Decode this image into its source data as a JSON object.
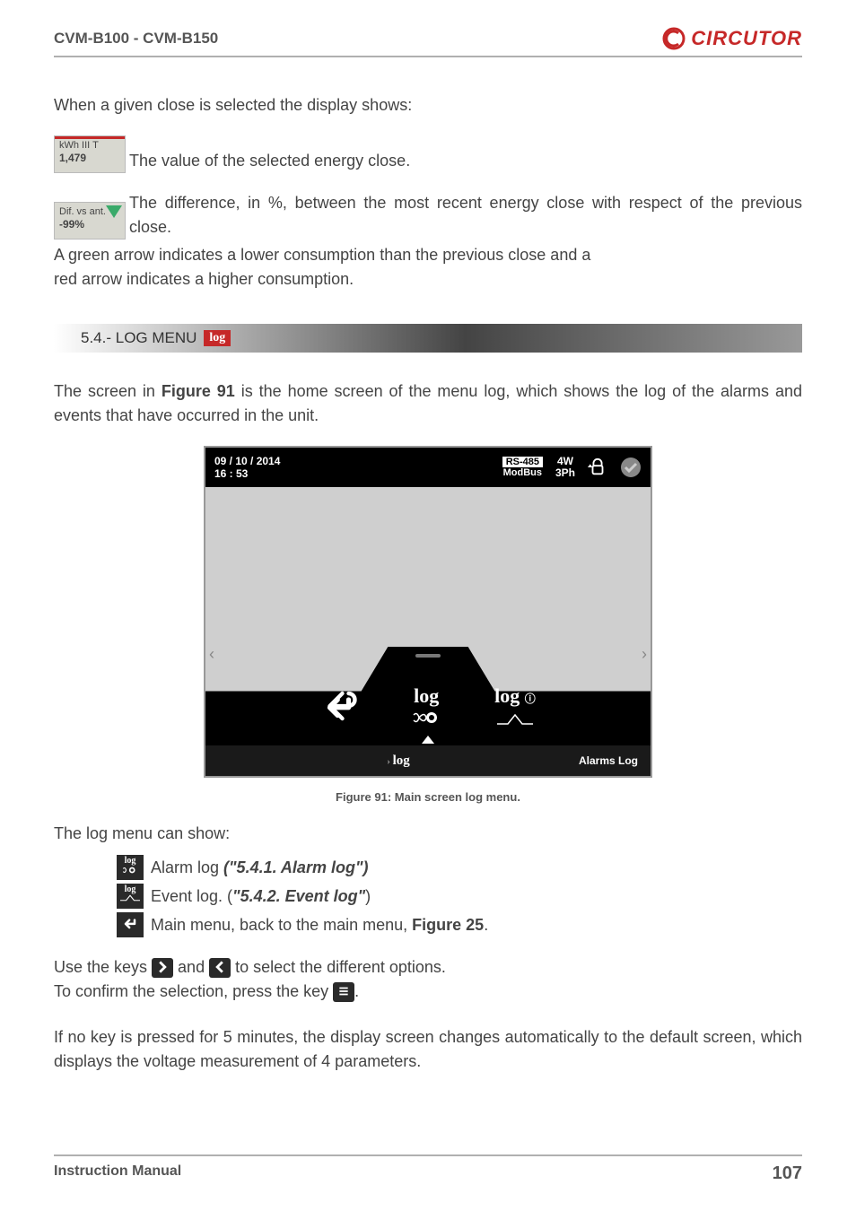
{
  "header": {
    "title": "CVM-B100 - CVM-B150",
    "brand": "CIRCUTOR"
  },
  "intro": "When a given close is selected the display shows:",
  "lcd1": {
    "line1": "kWh III T",
    "line2": "1,479",
    "desc": " The value of the selected energy close."
  },
  "lcd2": {
    "line1": "Dif. vs ant.",
    "line2": "-99%",
    "desc": "The difference, in %, between the most recent energy close with respect of the previous close."
  },
  "arrow_note1": "A green arrow indicates a lower consumption than the previous close and a",
  "arrow_note2": "red arrow indicates a higher consumption.",
  "section": {
    "num_title": "5.4.- LOG MENU",
    "badge": "log"
  },
  "after_section1": "The screen in ",
  "fig_ref1": "Figure 91",
  "after_section2": "  is the home screen of the menu log, which shows the log of the alarms and events that have occurred in the unit.",
  "device": {
    "date": "09 / 10 / 2014",
    "time": "16 : 53",
    "rs_top": "RS-485",
    "rs_bot": "ModBus",
    "mode1": "4W",
    "mode2": "3Ph",
    "tab_center": "log",
    "footer_center": "log",
    "footer_right": "Alarms Log"
  },
  "caption": "Figure 91: Main screen log menu.",
  "can_show": "The log menu can show:",
  "items": {
    "alarm_pre": " Alarm log ",
    "alarm_ref": "(\"5.4.1. Alarm log\")",
    "event_pre": " Event log. (",
    "event_ref": "\"5.4.2. Event log\"",
    "event_post": ")",
    "main_pre": " Main menu, back to the main menu, ",
    "main_ref": "Figure 25",
    "main_post": "."
  },
  "keys_line_a": "Use the keys ",
  "keys_line_b": " and ",
  "keys_line_c": " to select the different options.",
  "confirm_a": "To confirm the selection, press the key ",
  "confirm_b": ".",
  "timeout": "If no key is pressed for 5 minutes, the display screen changes automatically to the default screen, which displays the voltage measurement of 4 parameters.",
  "footer": {
    "left": "Instruction Manual",
    "right": "107"
  }
}
